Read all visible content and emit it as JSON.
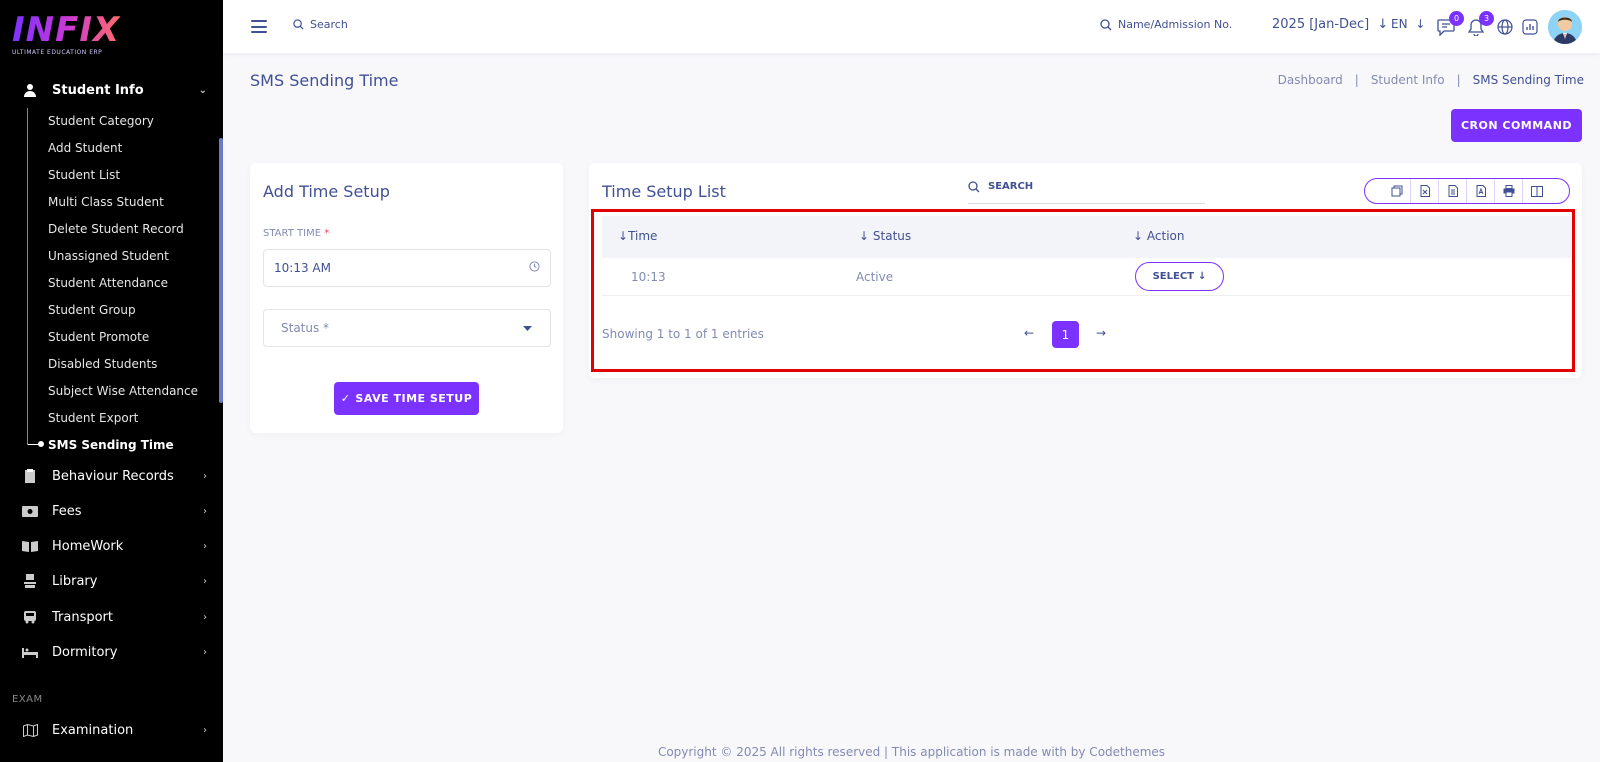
{
  "brand": {
    "logo": "INFIX",
    "tagline": "ULTIMATE EDUCATION ERP"
  },
  "sidebar": {
    "group_title": "Student Info",
    "sub_items": [
      "Student Category",
      "Add Student",
      "Student List",
      "Multi Class Student",
      "Delete Student Record",
      "Unassigned Student",
      "Student Attendance",
      "Student Group",
      "Student Promote",
      "Disabled Students",
      "Subject Wise Attendance",
      "Student Export",
      "SMS Sending Time"
    ],
    "active_item": "SMS Sending Time",
    "main_items": [
      "Behaviour Records",
      "Fees",
      "HomeWork",
      "Library",
      "Transport",
      "Dormitory"
    ],
    "section_label": "EXAM",
    "exam_items": [
      "Examination"
    ]
  },
  "topbar": {
    "search_label": "Search",
    "name_search_label": "Name/Admission No.",
    "academic_year": "2025 [Jan-Dec]",
    "language": "EN",
    "messages_count": "0",
    "notifications_count": "3"
  },
  "page": {
    "title": "SMS Sending Time",
    "breadcrumb": [
      "Dashboard",
      "Student Info",
      "SMS Sending Time"
    ],
    "cron_button": "CRON COMMAND"
  },
  "add_form": {
    "title": "Add Time Setup",
    "start_time_label": "START TIME",
    "required_mark": "*",
    "start_time_value": "10:13 AM",
    "status_placeholder": "Status *",
    "save_button": "SAVE TIME SETUP",
    "save_check": "✓"
  },
  "list": {
    "title": "Time Setup List",
    "search_placeholder": "SEARCH",
    "export_icons": [
      "copy-icon",
      "excel-icon",
      "csv-icon",
      "pdf-icon",
      "print-icon",
      "columns-icon"
    ],
    "columns": [
      "Time",
      "Status",
      "Action"
    ],
    "rows": [
      {
        "time": "10:13",
        "status": "Active",
        "action": "SELECT"
      }
    ],
    "showing_text": "Showing 1 to 1 of 1 entries",
    "current_page": "1"
  },
  "footer": {
    "text": "Copyright © 2025 All rights reserved | This application is made with by Codethemes"
  },
  "colors": {
    "accent": "#7c32ff",
    "sidebar_bg": "#000000",
    "text": "#415094",
    "muted": "#828bb2",
    "highlight": "#e20000"
  }
}
